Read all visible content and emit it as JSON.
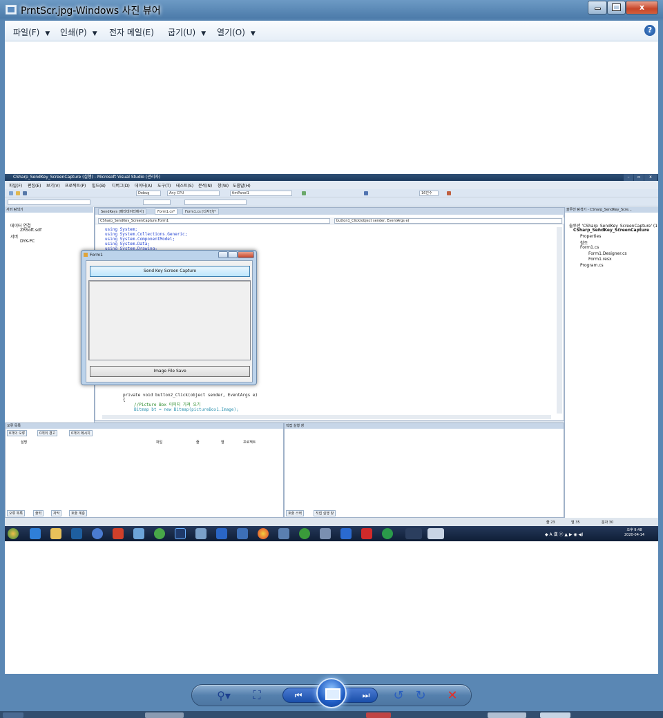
{
  "window": {
    "title": "PrntScr.jpg-Windows 사진 뷰어",
    "controls": {
      "close": "x"
    }
  },
  "menubar": {
    "items": [
      {
        "label": "파일(F)"
      },
      {
        "label": "인쇄(P)"
      },
      {
        "label": "전자 메일(E)"
      },
      {
        "label": "굽기(U)"
      },
      {
        "label": "열기(O)"
      }
    ],
    "arrow": "▼",
    "help": "?"
  },
  "photo": {
    "vs_title": "CSharp_SendKey_ScreenCapture (실행) - Microsoft Visual Studio (관리자)",
    "vs_menu": [
      "파일(F)",
      "편집(E)",
      "보기(V)",
      "프로젝트(P)",
      "빌드(B)",
      "디버그(D)",
      "데이터(A)",
      "도구(T)",
      "테스트(S)",
      "분석(N)",
      "창(W)",
      "도움말(H)"
    ],
    "toolbar": {
      "config": "Debug",
      "platform": "Any CPU",
      "target": "tlmPanel1",
      "zoom": "16진수"
    },
    "server_panel": {
      "title": "서버 탐색기",
      "rows": [
        "데이터 연결",
        "ZRSoft.sdf",
        "서버",
        "DYK-PC"
      ]
    },
    "editor": {
      "tabs": [
        "SendKeys [메타데이터에서]",
        "Form1.cs*",
        "Form1.cs [디자인]*"
      ],
      "class_selector": "CSharp_SendKey_ScreenCapture.Form1",
      "member_selector": "button1_Click(object sender, EventArgs e)",
      "using_lines": [
        "using System;",
        "using System.Collections.Generic;",
        "using System.ComponentModel;",
        "using System.Data;",
        "using System.Drawing;"
      ],
      "method_line": "private void button2_Click(object sender, EventArgs e)",
      "brace": "{",
      "comment": "//Picture Box 이미지 가져 오기",
      "bitmap_line": "Bitmap bt = new Bitmap(pictureBox1.Image);"
    },
    "solution": {
      "title": "솔루션 탐색기 - CSharp_SendKey_Scre...",
      "rows": [
        "솔루션 'CSharp_SendKey_ScreenCapture' (1 프로",
        "CSharp_SendKey_ScreenCapture",
        "Properties",
        "참조",
        "Form1.cs",
        "Form1.Designer.cs",
        "Form1.resx",
        "Program.cs"
      ]
    },
    "errlist": {
      "title": "오류 목록",
      "filters": [
        "0개의 오류",
        "0개의 경고",
        "0개의 메시지"
      ],
      "columns": [
        "설명",
        "파일",
        "줄",
        "열",
        "프로젝트"
      ],
      "tabs": [
        "오류 목록",
        "출력",
        "자막",
        "호출 계층"
      ]
    },
    "output": {
      "title": "직접 실행 창",
      "tabs": [
        "호출 스택",
        "직접 실행 창"
      ]
    },
    "status": {
      "line": "줄 23",
      "col": "열 35",
      "ch": "문자 30"
    },
    "clock": {
      "time": "오후 9:48",
      "date": "2020-04-14"
    },
    "form1": {
      "title": "Form1",
      "capture_button": "Send Key Screen Capture",
      "save_button": "Image File Save"
    }
  },
  "controls_bar": {
    "zoom": "⚲▾",
    "fit": "⛶",
    "prev": "⏮",
    "next": "⏭",
    "rotate_left": "↺",
    "rotate_right": "↻",
    "delete": "✕"
  }
}
